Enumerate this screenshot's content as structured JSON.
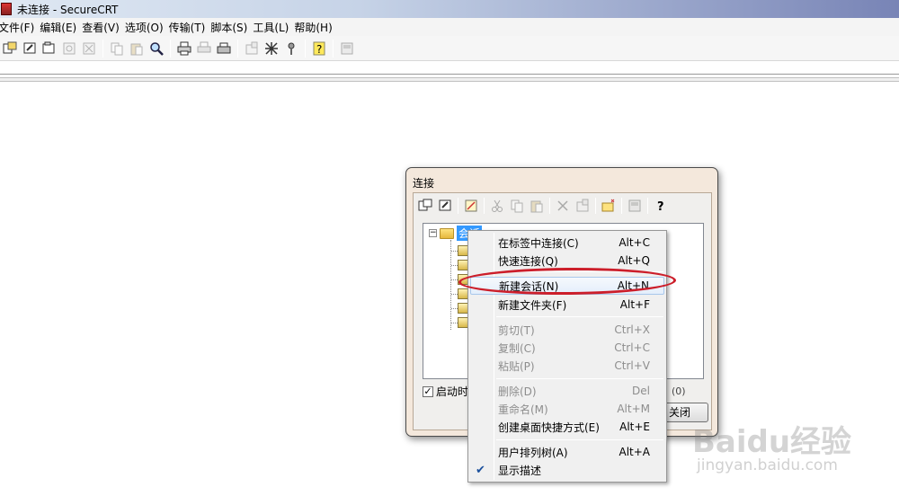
{
  "window": {
    "title": "未连接 - SecureCRT"
  },
  "menu": [
    "文件(F)",
    "编辑(E)",
    "查看(V)",
    "选项(O)",
    "传输(T)",
    "脚本(S)",
    "工具(L)",
    "帮助(H)"
  ],
  "toolbar_icons": [
    "connect-icon",
    "quick-connect-icon",
    "connect-in-tab-icon",
    "reconnect-icon",
    "disconnect-icon",
    "copy-icon",
    "paste-icon",
    "find-icon",
    "print-icon",
    "print-selection-icon",
    "print-setup-icon",
    "session-options-icon",
    "global-options-icon",
    "keymap-icon",
    "help-icon",
    "about-icon"
  ],
  "dialog": {
    "title": "连接",
    "tree_root_label": "会话",
    "startup_checkbox_label": "启动时显",
    "startup_checked": true,
    "count_text": "(0)",
    "close_button_label": "关闭"
  },
  "context_menu": {
    "items": [
      {
        "label": "在标签中连接(C)",
        "shortcut": "Alt+C",
        "disabled": false
      },
      {
        "label": "快速连接(Q)",
        "shortcut": "Alt+Q",
        "disabled": false
      },
      {
        "label": "新建会话(N)",
        "shortcut": "Alt+N",
        "disabled": false,
        "highlighted": true
      },
      {
        "label": "新建文件夹(F)",
        "shortcut": "Alt+F",
        "disabled": false
      },
      {
        "label": "剪切(T)",
        "shortcut": "Ctrl+X",
        "disabled": true
      },
      {
        "label": "复制(C)",
        "shortcut": "Ctrl+C",
        "disabled": true
      },
      {
        "label": "粘贴(P)",
        "shortcut": "Ctrl+V",
        "disabled": true
      },
      {
        "label": "删除(D)",
        "shortcut": "Del",
        "disabled": true
      },
      {
        "label": "重命名(M)",
        "shortcut": "Alt+M",
        "disabled": true
      },
      {
        "label": "创建桌面快捷方式(E)",
        "shortcut": "Alt+E",
        "disabled": false
      },
      {
        "label": "用户排列树(A)",
        "shortcut": "Alt+A",
        "disabled": false
      },
      {
        "label": "显示描述",
        "shortcut": "",
        "disabled": false,
        "checked": true
      }
    ]
  },
  "watermark": {
    "logo": "Baidu经验",
    "url": "jingyan.baidu.com"
  },
  "colors": {
    "highlight_oval": "#cc1e2a",
    "selection": "#3399ff"
  }
}
